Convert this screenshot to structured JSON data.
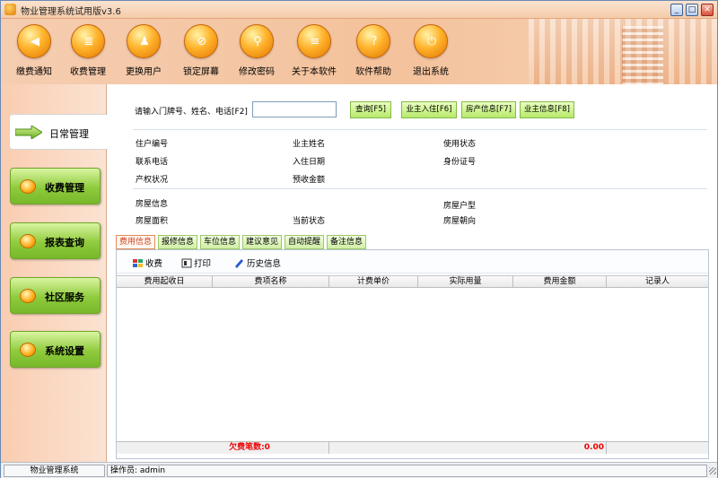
{
  "window": {
    "title": "物业管理系统试用版v3.6",
    "min": "_",
    "max": "□",
    "close": "✕"
  },
  "toolbar": [
    {
      "label": "缴费通知",
      "icon": "megaphone-icon",
      "glyph": "◀"
    },
    {
      "label": "收费管理",
      "icon": "ledger-icon",
      "glyph": "≣"
    },
    {
      "label": "更换用户",
      "icon": "users-icon",
      "glyph": "♟"
    },
    {
      "label": "锁定屏幕",
      "icon": "lock-screen-icon",
      "glyph": "⊘"
    },
    {
      "label": "修改密码",
      "icon": "key-icon",
      "glyph": "⚲"
    },
    {
      "label": "关于本软件",
      "icon": "document-icon",
      "glyph": "≡"
    },
    {
      "label": "软件帮助",
      "icon": "help-icon",
      "glyph": "?"
    },
    {
      "label": "退出系统",
      "icon": "power-icon",
      "glyph": "⏻"
    }
  ],
  "sidebar": {
    "active": "日常管理",
    "items": [
      {
        "label": "收费管理"
      },
      {
        "label": "报表查询"
      },
      {
        "label": "社区服务"
      },
      {
        "label": "系统设置"
      }
    ]
  },
  "search": {
    "prompt": "请输入门牌号、姓名、电话[F2]",
    "value": "",
    "query_btn": "查询[F5]",
    "btn_checkin": "业主入住[F6]",
    "btn_house": "房产信息[F7]",
    "btn_owner": "业主信息[F8]"
  },
  "info": {
    "household_no": "住户编号",
    "owner_name": "业主姓名",
    "use_status": "使用状态",
    "phone": "联系电话",
    "checkin_date": "入住日期",
    "id_no": "身份证号",
    "property_status": "产权状况",
    "prepaid": "预收金额",
    "house_info": "房屋信息",
    "house_type": "房屋户型",
    "house_area": "房屋面积",
    "current_status": "当前状态",
    "orientation": "房屋朝向"
  },
  "tabs": [
    "费用信息",
    "报修信息",
    "车位信息",
    "建议意见",
    "自动提醒",
    "备注信息"
  ],
  "panel": {
    "tool_charge": "收费",
    "tool_print": "打印",
    "tool_history": "历史信息"
  },
  "grid": {
    "columns": [
      "费用起收日",
      "费项名称",
      "计费单价",
      "实际用量",
      "费用金额",
      "记录人"
    ],
    "footer_count": "欠费笔数:0",
    "footer_amount": "0.00"
  },
  "status": {
    "app": "物业管理系统",
    "operator": "操作员: admin"
  },
  "colors": {
    "accent_orange": "#f4c29c",
    "sidebar_green": "#8fcb3d",
    "alert_red": "#e00000"
  }
}
